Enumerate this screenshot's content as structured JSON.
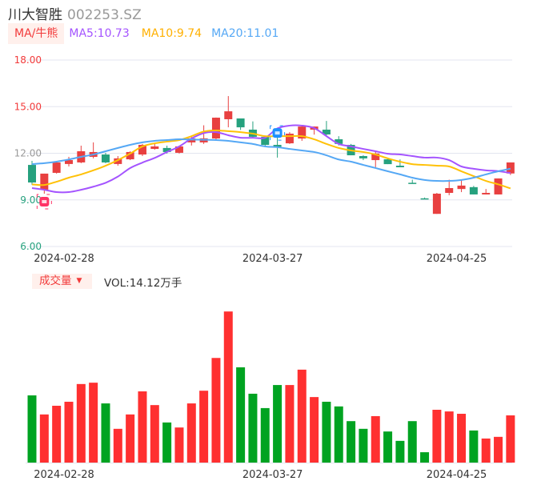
{
  "header": {
    "name": "川大智胜",
    "code": "002253.SZ"
  },
  "ma_bar": {
    "toggle_label": "MA/牛熊",
    "ma5": "MA5:10.73",
    "ma10": "MA10:9.74",
    "ma20": "MA20:11.01"
  },
  "volume_bar": {
    "toggle_label": "成交量",
    "toggle_arrow": "▼",
    "vol": "VOL:14.12万手"
  },
  "colors": {
    "up": "#e84040",
    "down": "#26a17e",
    "vol_up": "#ff3030",
    "vol_down": "#00a321",
    "ma5": "#a454ff",
    "ma10": "#ffc107",
    "ma20": "#55a8f5",
    "grid": "#e3e6f0"
  },
  "chart_data": [
    {
      "type": "candlestick",
      "title": "川大智胜 002253.SZ",
      "ylim": [
        6,
        18
      ],
      "y_ticks": [
        "18.00",
        "15.00",
        "12.00",
        "9.00",
        "6.00"
      ],
      "y_tick_values": [
        18,
        15,
        12,
        9,
        6
      ],
      "x_tick_labels": [
        {
          "index": 3,
          "label": "2024-02-28"
        },
        {
          "index": 20,
          "label": "2024-03-27"
        },
        {
          "index": 35,
          "label": "2024-04-25"
        }
      ],
      "ohlc": [
        [
          11.25,
          10.12,
          11.51,
          9.97
        ],
        [
          9.66,
          10.69,
          10.69,
          9.4
        ],
        [
          10.74,
          11.41,
          11.51,
          10.69
        ],
        [
          11.31,
          11.56,
          11.77,
          11.15
        ],
        [
          11.41,
          12.13,
          12.49,
          11.36
        ],
        [
          11.77,
          12.08,
          12.7,
          11.67
        ],
        [
          11.92,
          11.41,
          12.03,
          11.36
        ],
        [
          11.31,
          11.67,
          11.82,
          11.2
        ],
        [
          11.61,
          12.08,
          12.13,
          11.56
        ],
        [
          11.92,
          12.54,
          12.6,
          11.82
        ],
        [
          12.28,
          12.44,
          12.6,
          12.23
        ],
        [
          12.34,
          12.08,
          12.49,
          11.98
        ],
        [
          12.03,
          12.44,
          12.49,
          11.98
        ],
        [
          12.7,
          12.96,
          13.1,
          12.5
        ],
        [
          12.7,
          12.96,
          13.8,
          12.6
        ],
        [
          12.95,
          14.29,
          14.3,
          12.9
        ],
        [
          14.19,
          14.7,
          15.68,
          13.67
        ],
        [
          14.24,
          13.67,
          14.24,
          13.5
        ],
        [
          13.52,
          13.06,
          14.05,
          13.0
        ],
        [
          13.06,
          12.54,
          13.06,
          12.4
        ],
        [
          12.54,
          12.39,
          13.1,
          11.72
        ],
        [
          12.64,
          13.26,
          13.36,
          12.6
        ],
        [
          12.95,
          13.72,
          13.82,
          12.8
        ],
        [
          13.52,
          13.72,
          13.72,
          13.2
        ],
        [
          13.52,
          13.21,
          14.08,
          13.1
        ],
        [
          12.9,
          12.6,
          13.1,
          12.5
        ],
        [
          12.54,
          11.87,
          12.6,
          11.87
        ],
        [
          11.82,
          11.67,
          11.87,
          11.56
        ],
        [
          11.56,
          11.98,
          12.1,
          11.1
        ],
        [
          11.61,
          11.3,
          11.72,
          11.3
        ],
        [
          11.2,
          11.1,
          11.6,
          11.1
        ],
        [
          10.1,
          10.05,
          10.3,
          10.05
        ],
        [
          9.1,
          9.05,
          9.15,
          9.05
        ],
        [
          8.1,
          9.4,
          9.45,
          8.1
        ],
        [
          9.45,
          9.76,
          10.3,
          9.3
        ],
        [
          9.7,
          9.92,
          10.3,
          9.5
        ],
        [
          9.82,
          9.35,
          9.9,
          9.35
        ],
        [
          9.35,
          9.45,
          9.7,
          9.35
        ],
        [
          9.35,
          10.38,
          10.38,
          9.35
        ],
        [
          10.7,
          11.41,
          11.41,
          10.6
        ]
      ],
      "series": [
        {
          "name": "MA5",
          "values": [
            9.76,
            9.65,
            9.5,
            9.5,
            9.65,
            9.85,
            10.1,
            10.5,
            11.05,
            11.4,
            11.7,
            12.08,
            12.44,
            12.95,
            13.3,
            13.36,
            13.16,
            13.0,
            13.0,
            13.0,
            13.6,
            13.78,
            13.78,
            13.62,
            13.1,
            12.6,
            12.44,
            12.28,
            12.13,
            11.97,
            11.92,
            11.82,
            11.72,
            11.72,
            11.56,
            11.15,
            11.0,
            10.9,
            10.85,
            10.73
          ]
        },
        {
          "name": "MA10",
          "values": [
            10.0,
            9.96,
            10.17,
            10.43,
            10.64,
            10.9,
            11.2,
            11.56,
            11.98,
            12.44,
            12.64,
            12.75,
            12.85,
            13.1,
            13.4,
            13.47,
            13.42,
            13.36,
            13.26,
            13.1,
            13.1,
            13.1,
            13.1,
            12.9,
            12.6,
            12.34,
            12.18,
            12.08,
            11.92,
            11.67,
            11.46,
            11.3,
            11.25,
            11.2,
            11.15,
            10.84,
            10.53,
            10.22,
            10.0,
            9.74
          ]
        },
        {
          "name": "MA20",
          "values": [
            11.3,
            11.36,
            11.46,
            11.6,
            11.77,
            11.92,
            12.13,
            12.34,
            12.54,
            12.7,
            12.8,
            12.85,
            12.9,
            12.88,
            12.87,
            12.85,
            12.8,
            12.7,
            12.6,
            12.44,
            12.39,
            12.28,
            12.18,
            12.08,
            11.87,
            11.6,
            11.46,
            11.25,
            11.05,
            10.84,
            10.64,
            10.43,
            10.28,
            10.22,
            10.22,
            10.28,
            10.43,
            10.64,
            10.84,
            11.01
          ]
        }
      ],
      "markers": [
        {
          "index": 1,
          "kind": "low",
          "color": "#ff3366"
        },
        {
          "index": 20,
          "kind": "high",
          "color": "#1e90ff"
        }
      ]
    },
    {
      "type": "bar",
      "title": "成交量",
      "unit": "万手",
      "ylim": [
        0,
        47.4
      ],
      "values": [
        20.1,
        14.4,
        17.0,
        18.2,
        23.5,
        23.9,
        17.7,
        10.1,
        14.4,
        21.3,
        17.2,
        12.0,
        10.5,
        17.7,
        21.5,
        31.3,
        45.2,
        28.5,
        20.6,
        16.3,
        23.2,
        23.2,
        27.8,
        19.6,
        18.2,
        16.8,
        12.4,
        10.1,
        13.9,
        9.3,
        6.5,
        12.4,
        3.1,
        15.8,
        15.3,
        14.6,
        9.6,
        7.2,
        7.7,
        14.12
      ],
      "x_tick_labels": [
        {
          "index": 3,
          "label": "2024-02-28"
        },
        {
          "index": 20,
          "label": "2024-03-27"
        },
        {
          "index": 35,
          "label": "2024-04-25"
        }
      ]
    }
  ]
}
